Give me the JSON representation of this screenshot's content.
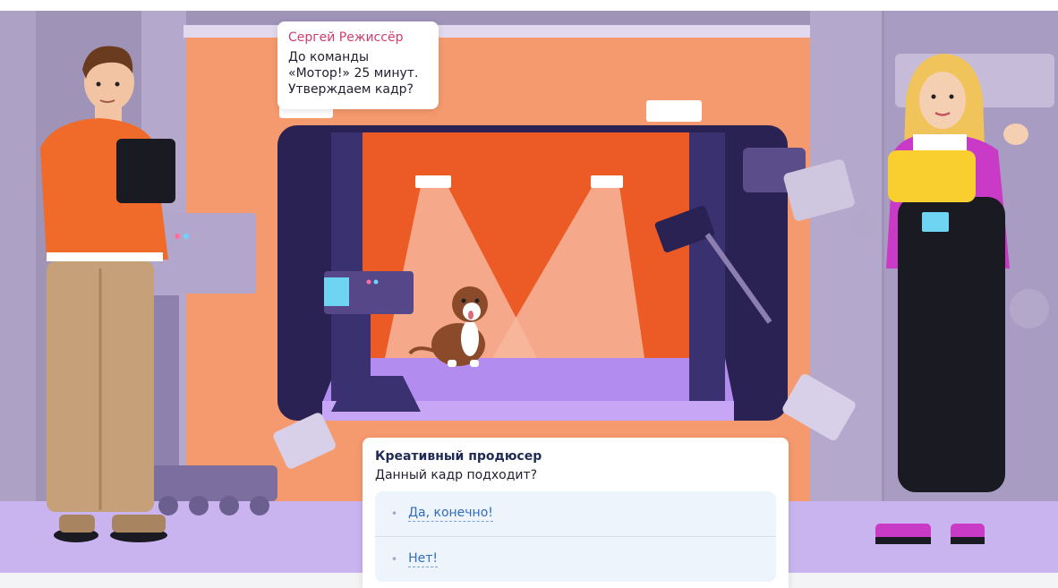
{
  "dialogue": {
    "director": {
      "name": "Сергей Режиссёр",
      "message": "До команды\n«Мотор!» 25 минут.\nУтверждаем кадр?"
    },
    "producer": {
      "name": "Креативный продюсер",
      "question": "Данный кадр подходит?",
      "options": [
        {
          "label": "Да, конечно!"
        },
        {
          "label": "Нет!"
        }
      ]
    }
  },
  "colors": {
    "background_wall": "#9f93b8",
    "orange_wall": "#f59a6e",
    "stage_backdrop": "#ec5a26",
    "stage_floor": "#b38cf0",
    "frame_dark": "#2a2252",
    "director_name": "#d03d6b",
    "option_link": "#2f6bbf"
  }
}
